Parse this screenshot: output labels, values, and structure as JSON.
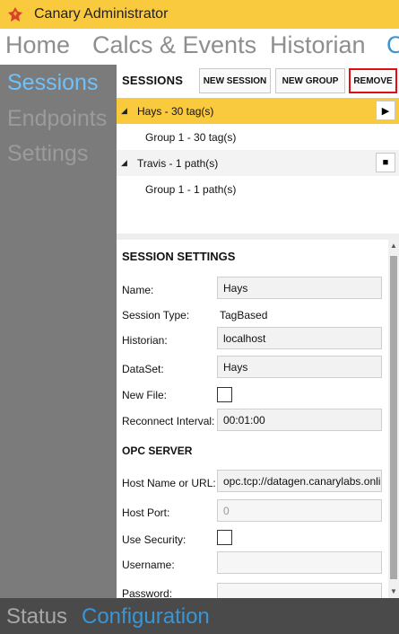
{
  "window": {
    "title": "Canary Administrator"
  },
  "topnav": {
    "home": "Home",
    "calcs": "Calcs & Events",
    "historian": "Historian",
    "overflow": "C"
  },
  "sidebar": {
    "items": [
      {
        "label": "Sessions"
      },
      {
        "label": "Endpoints"
      },
      {
        "label": "Settings"
      }
    ]
  },
  "sessions": {
    "title": "SESSIONS",
    "new_session": "NEW SESSION",
    "new_group": "NEW GROUP",
    "remove": "REMOVE",
    "tree": [
      {
        "label": "Hays - 30 tag(s)",
        "child": "Group 1 - 30 tag(s)",
        "control": "play"
      },
      {
        "label": "Travis - 1 path(s)",
        "child": "Group 1 - 1 path(s)",
        "control": "stop"
      }
    ]
  },
  "session_settings": {
    "title": "SESSION SETTINGS",
    "name_label": "Name:",
    "name_value": "Hays",
    "type_label": "Session Type:",
    "type_value": "TagBased",
    "historian_label": "Historian:",
    "historian_value": "localhost",
    "dataset_label": "DataSet:",
    "dataset_value": "Hays",
    "newfile_label": "New File:",
    "reconnect_label": "Reconnect Interval:",
    "reconnect_value": "00:01:00"
  },
  "opc_server": {
    "title": "OPC SERVER",
    "host_label": "Host Name or URL:",
    "host_value": "opc.tcp://datagen.canarylabs.online",
    "port_label": "Host Port:",
    "port_placeholder": "0",
    "security_label": "Use Security:",
    "username_label": "Username:",
    "username_value": "",
    "password_label": "Password:",
    "password_value": ""
  },
  "statusbar": {
    "status": "Status",
    "configuration": "Configuration"
  },
  "colors": {
    "accent_yellow": "#f9c93e",
    "accent_blue": "#3a95d4",
    "remove_border": "#e01010"
  },
  "icons": {
    "logo": "canary-logo-icon",
    "expand": "triangle-down-icon",
    "play": "play-icon",
    "stop": "stop-icon"
  }
}
